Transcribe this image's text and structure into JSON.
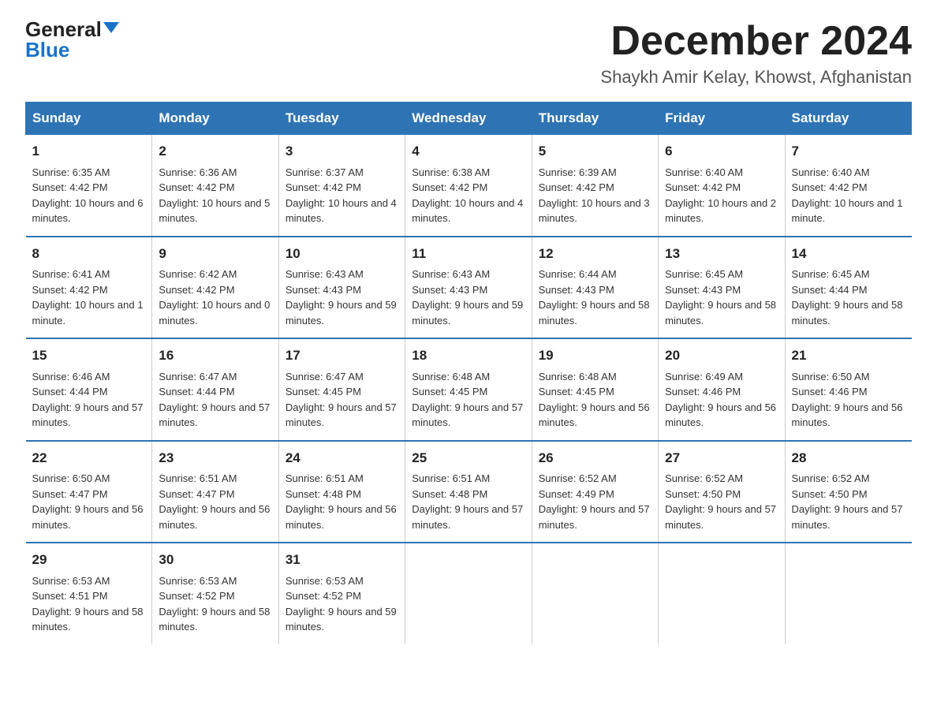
{
  "title": "December 2024",
  "subtitle": "Shaykh Amir Kelay, Khowst, Afghanistan",
  "logo": {
    "general": "General",
    "blue": "Blue"
  },
  "days_of_week": [
    "Sunday",
    "Monday",
    "Tuesday",
    "Wednesday",
    "Thursday",
    "Friday",
    "Saturday"
  ],
  "weeks": [
    [
      {
        "day": "1",
        "sunrise": "6:35 AM",
        "sunset": "4:42 PM",
        "daylight": "10 hours and 6 minutes."
      },
      {
        "day": "2",
        "sunrise": "6:36 AM",
        "sunset": "4:42 PM",
        "daylight": "10 hours and 5 minutes."
      },
      {
        "day": "3",
        "sunrise": "6:37 AM",
        "sunset": "4:42 PM",
        "daylight": "10 hours and 4 minutes."
      },
      {
        "day": "4",
        "sunrise": "6:38 AM",
        "sunset": "4:42 PM",
        "daylight": "10 hours and 4 minutes."
      },
      {
        "day": "5",
        "sunrise": "6:39 AM",
        "sunset": "4:42 PM",
        "daylight": "10 hours and 3 minutes."
      },
      {
        "day": "6",
        "sunrise": "6:40 AM",
        "sunset": "4:42 PM",
        "daylight": "10 hours and 2 minutes."
      },
      {
        "day": "7",
        "sunrise": "6:40 AM",
        "sunset": "4:42 PM",
        "daylight": "10 hours and 1 minute."
      }
    ],
    [
      {
        "day": "8",
        "sunrise": "6:41 AM",
        "sunset": "4:42 PM",
        "daylight": "10 hours and 1 minute."
      },
      {
        "day": "9",
        "sunrise": "6:42 AM",
        "sunset": "4:42 PM",
        "daylight": "10 hours and 0 minutes."
      },
      {
        "day": "10",
        "sunrise": "6:43 AM",
        "sunset": "4:43 PM",
        "daylight": "9 hours and 59 minutes."
      },
      {
        "day": "11",
        "sunrise": "6:43 AM",
        "sunset": "4:43 PM",
        "daylight": "9 hours and 59 minutes."
      },
      {
        "day": "12",
        "sunrise": "6:44 AM",
        "sunset": "4:43 PM",
        "daylight": "9 hours and 58 minutes."
      },
      {
        "day": "13",
        "sunrise": "6:45 AM",
        "sunset": "4:43 PM",
        "daylight": "9 hours and 58 minutes."
      },
      {
        "day": "14",
        "sunrise": "6:45 AM",
        "sunset": "4:44 PM",
        "daylight": "9 hours and 58 minutes."
      }
    ],
    [
      {
        "day": "15",
        "sunrise": "6:46 AM",
        "sunset": "4:44 PM",
        "daylight": "9 hours and 57 minutes."
      },
      {
        "day": "16",
        "sunrise": "6:47 AM",
        "sunset": "4:44 PM",
        "daylight": "9 hours and 57 minutes."
      },
      {
        "day": "17",
        "sunrise": "6:47 AM",
        "sunset": "4:45 PM",
        "daylight": "9 hours and 57 minutes."
      },
      {
        "day": "18",
        "sunrise": "6:48 AM",
        "sunset": "4:45 PM",
        "daylight": "9 hours and 57 minutes."
      },
      {
        "day": "19",
        "sunrise": "6:48 AM",
        "sunset": "4:45 PM",
        "daylight": "9 hours and 56 minutes."
      },
      {
        "day": "20",
        "sunrise": "6:49 AM",
        "sunset": "4:46 PM",
        "daylight": "9 hours and 56 minutes."
      },
      {
        "day": "21",
        "sunrise": "6:50 AM",
        "sunset": "4:46 PM",
        "daylight": "9 hours and 56 minutes."
      }
    ],
    [
      {
        "day": "22",
        "sunrise": "6:50 AM",
        "sunset": "4:47 PM",
        "daylight": "9 hours and 56 minutes."
      },
      {
        "day": "23",
        "sunrise": "6:51 AM",
        "sunset": "4:47 PM",
        "daylight": "9 hours and 56 minutes."
      },
      {
        "day": "24",
        "sunrise": "6:51 AM",
        "sunset": "4:48 PM",
        "daylight": "9 hours and 56 minutes."
      },
      {
        "day": "25",
        "sunrise": "6:51 AM",
        "sunset": "4:48 PM",
        "daylight": "9 hours and 57 minutes."
      },
      {
        "day": "26",
        "sunrise": "6:52 AM",
        "sunset": "4:49 PM",
        "daylight": "9 hours and 57 minutes."
      },
      {
        "day": "27",
        "sunrise": "6:52 AM",
        "sunset": "4:50 PM",
        "daylight": "9 hours and 57 minutes."
      },
      {
        "day": "28",
        "sunrise": "6:52 AM",
        "sunset": "4:50 PM",
        "daylight": "9 hours and 57 minutes."
      }
    ],
    [
      {
        "day": "29",
        "sunrise": "6:53 AM",
        "sunset": "4:51 PM",
        "daylight": "9 hours and 58 minutes."
      },
      {
        "day": "30",
        "sunrise": "6:53 AM",
        "sunset": "4:52 PM",
        "daylight": "9 hours and 58 minutes."
      },
      {
        "day": "31",
        "sunrise": "6:53 AM",
        "sunset": "4:52 PM",
        "daylight": "9 hours and 59 minutes."
      },
      null,
      null,
      null,
      null
    ]
  ]
}
